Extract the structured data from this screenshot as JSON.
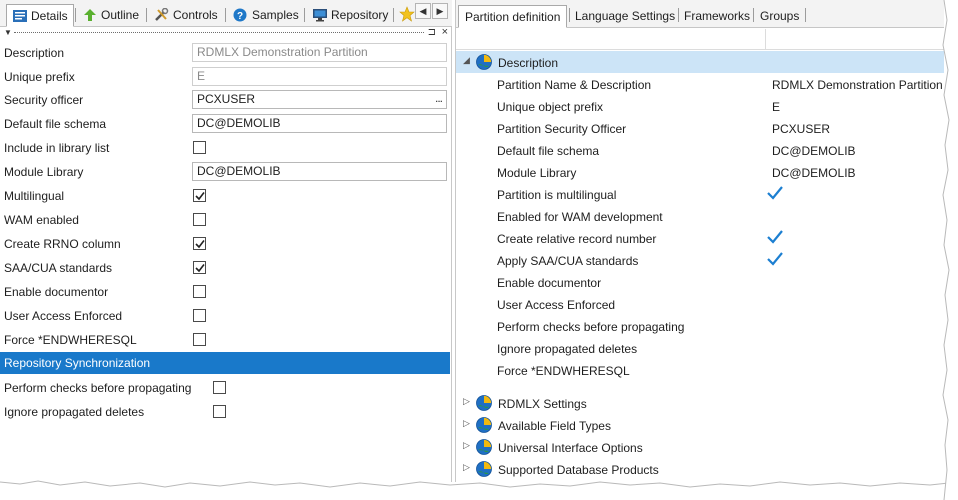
{
  "left": {
    "tabs": [
      {
        "label": "Details",
        "icon": "details-icon"
      },
      {
        "label": "Outline",
        "icon": "outline-icon"
      },
      {
        "label": "Controls",
        "icon": "controls-icon"
      },
      {
        "label": "Samples",
        "icon": "help-icon"
      },
      {
        "label": "Repository",
        "icon": "monitor-icon"
      }
    ],
    "properties": {
      "description": {
        "label": "Description",
        "value": "RDMLX Demonstration Partition"
      },
      "unique_prefix": {
        "label": "Unique prefix",
        "value": "E"
      },
      "security_officer": {
        "label": "Security officer",
        "value": "PCXUSER",
        "button": "..."
      },
      "default_file_schema": {
        "label": "Default file schema",
        "value": "DC@DEMOLIB"
      },
      "include_in_library_list": {
        "label": "Include in library list",
        "checked": false
      },
      "module_library": {
        "label": "Module Library",
        "value": "DC@DEMOLIB"
      },
      "multilingual": {
        "label": "Multilingual",
        "checked": true
      },
      "wam_enabled": {
        "label": "WAM enabled",
        "checked": false
      },
      "create_rrno": {
        "label": "Create RRNO column",
        "checked": true
      },
      "saa_cua": {
        "label": "SAA/CUA standards",
        "checked": true
      },
      "enable_documentor": {
        "label": "Enable documentor",
        "checked": false
      },
      "user_access_enforced": {
        "label": "User Access Enforced",
        "checked": false
      },
      "force_endwheresql": {
        "label": "Force *ENDWHERESQL",
        "checked": false
      }
    },
    "repo_sync": {
      "header": "Repository Synchronization",
      "perform_checks": {
        "label": "Perform checks before propagating",
        "checked": false
      },
      "ignore_deletes": {
        "label": "Ignore propagated deletes",
        "checked": false
      }
    }
  },
  "right": {
    "tabs": [
      "Partition definition",
      "Language Settings",
      "Frameworks",
      "Groups"
    ],
    "description_node": {
      "label": "Description",
      "rows": [
        {
          "label": "Partition Name & Description",
          "value": "RDMLX Demonstration Partition"
        },
        {
          "label": "Unique object prefix",
          "value": "E"
        },
        {
          "label": "Partition Security Officer",
          "value": "PCXUSER"
        },
        {
          "label": "Default file schema",
          "value": "DC@DEMOLIB"
        },
        {
          "label": "Module Library",
          "value": "DC@DEMOLIB"
        },
        {
          "label": "Partition is multilingual",
          "checked": true
        },
        {
          "label": "Enabled for WAM development",
          "checked": false
        },
        {
          "label": "Create relative record number",
          "checked": true
        },
        {
          "label": "Apply SAA/CUA standards",
          "checked": true
        },
        {
          "label": "Enable documentor",
          "checked": false
        },
        {
          "label": "User Access Enforced",
          "checked": false
        },
        {
          "label": "Perform checks before propagating",
          "checked": false
        },
        {
          "label": "Ignore propagated deletes",
          "checked": false
        },
        {
          "label": "Force *ENDWHERESQL",
          "checked": false
        }
      ]
    },
    "collapsed_nodes": [
      "RDMLX Settings",
      "Available Field Types",
      "Universal Interface Options",
      "Supported Database Products"
    ]
  },
  "colors": {
    "selection": "#1979ca",
    "tree_selection": "#cce4f7",
    "checkmark": "#1c7fd1"
  }
}
